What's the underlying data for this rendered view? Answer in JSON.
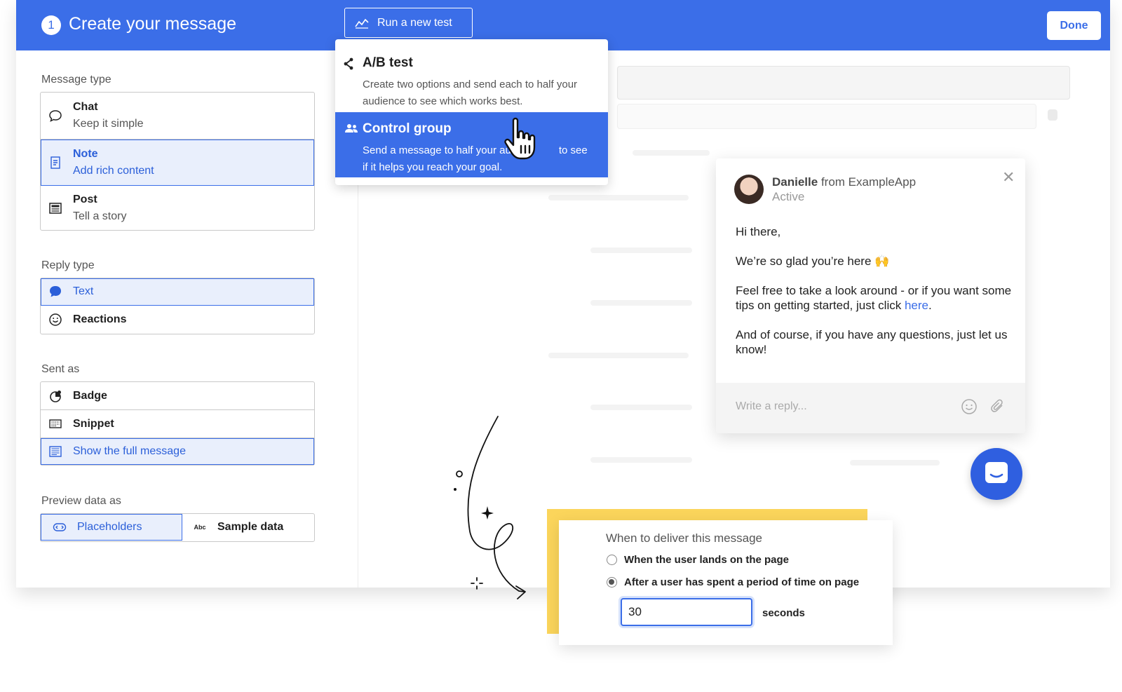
{
  "header": {
    "step": "1",
    "title": "Create your message",
    "run_test_label": "Run a new test",
    "done_label": "Done"
  },
  "sidebar": {
    "message_type": {
      "label": "Message type",
      "options": [
        {
          "title": "Chat",
          "subtitle": "Keep it simple",
          "icon": "chat-bubble-icon",
          "selected": false
        },
        {
          "title": "Note",
          "subtitle": "Add rich content",
          "icon": "note-icon",
          "selected": true
        },
        {
          "title": "Post",
          "subtitle": "Tell a story",
          "icon": "post-icon",
          "selected": false
        }
      ]
    },
    "reply_type": {
      "label": "Reply type",
      "options": [
        {
          "title": "Text",
          "icon": "speech-bubble-icon",
          "selected": true
        },
        {
          "title": "Reactions",
          "icon": "smiley-icon",
          "selected": false
        }
      ]
    },
    "sent_as": {
      "label": "Sent as",
      "options": [
        {
          "title": "Badge",
          "icon": "badge-icon",
          "selected": false
        },
        {
          "title": "Snippet",
          "icon": "snippet-icon",
          "selected": false
        },
        {
          "title": "Show the full message",
          "icon": "full-message-icon",
          "selected": true
        }
      ]
    },
    "preview_data": {
      "label": "Preview data as",
      "options": [
        {
          "title": "Placeholders",
          "icon": "placeholder-icon",
          "selected": true
        },
        {
          "title": "Sample data",
          "icon_text": "Abc",
          "selected": false
        }
      ]
    }
  },
  "dropdown": {
    "items": [
      {
        "title": "A/B test",
        "description": "Create two options and send each to half your audience to see which works best.",
        "icon": "branch-icon",
        "highlighted": false
      },
      {
        "title": "Control group",
        "description_line1": "Send a message to half your au",
        "description_line1_end": "to see",
        "description_line2": "if it helps you reach your goal.",
        "icon": "group-icon",
        "highlighted": true
      }
    ]
  },
  "chat": {
    "sender_name": "Danielle",
    "sender_org": "from ExampleApp",
    "status": "Active",
    "greeting": "Hi there,",
    "line2": "We’re so glad you’re here 🙌",
    "line3_pre": "Feel free to take a look around - or if you want some tips on getting started, just click ",
    "line3_link": "here",
    "line3_post": ".",
    "line4": "And of course, if you have any questions, just let us know!",
    "reply_placeholder": "Write a reply..."
  },
  "delivery": {
    "title": "When to deliver this message",
    "option1": "When the user lands on the page",
    "option2": "After a user has spent a period of time on page",
    "selected_option": 2,
    "seconds_value": "30",
    "seconds_label": "seconds"
  },
  "colors": {
    "brand": "#3b6ee8",
    "highlight_bg": "#e9effc",
    "accent_yellow": "#fbd55b"
  }
}
